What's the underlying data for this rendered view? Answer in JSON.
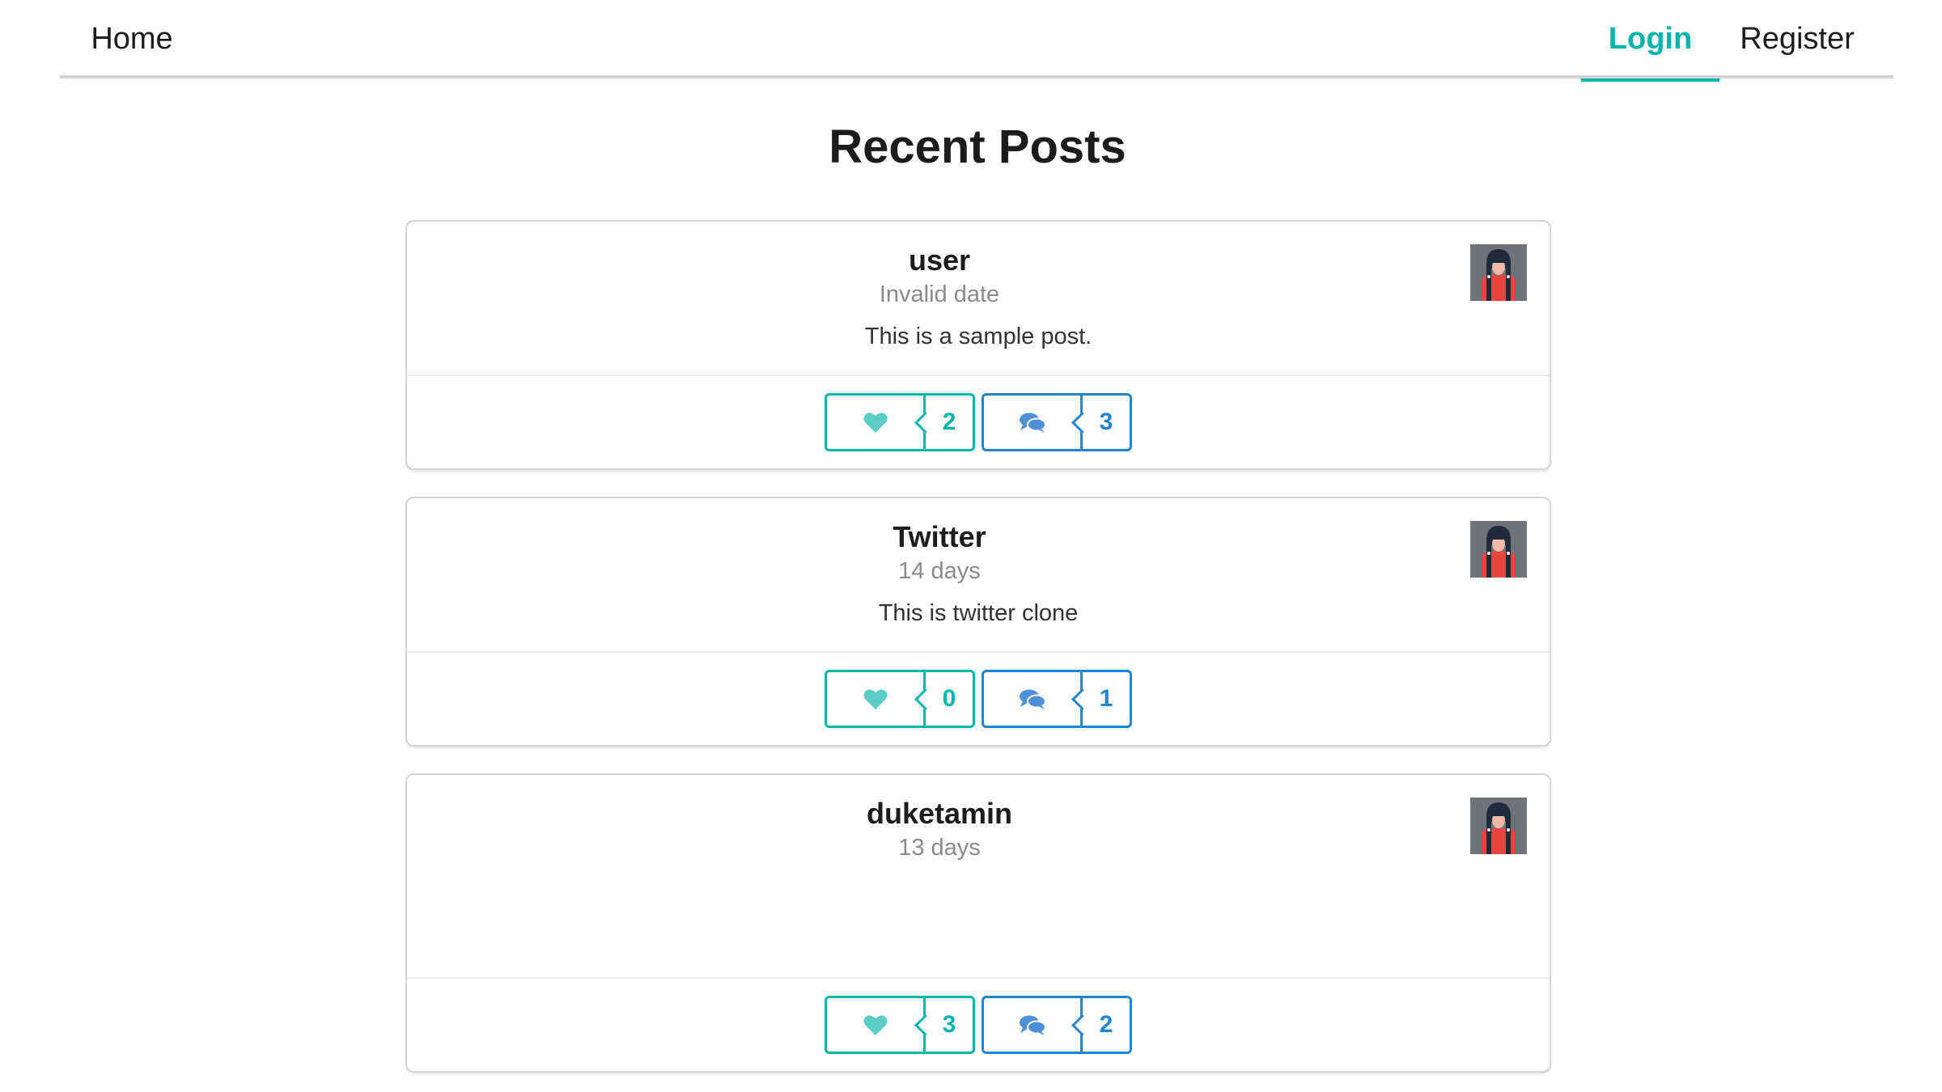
{
  "nav": {
    "home_label": "Home",
    "login_label": "Login",
    "register_label": "Register",
    "active_item": "Login"
  },
  "page": {
    "title": "Recent Posts"
  },
  "colors": {
    "teal": "#00b5ad",
    "blue": "#2185d0"
  },
  "posts": [
    {
      "author": "user",
      "meta": "Invalid date",
      "description": "This is a sample post.",
      "likes": "2",
      "comments": "3",
      "like_icon": "heart-icon",
      "comment_icon": "comments-icon"
    },
    {
      "author": "Twitter",
      "meta": "14 days",
      "description": "This is twitter clone",
      "likes": "0",
      "comments": "1",
      "like_icon": "heart-icon",
      "comment_icon": "comments-icon"
    },
    {
      "author": "duketamin",
      "meta": "13 days",
      "description": "",
      "likes": "3",
      "comments": "2",
      "like_icon": "heart-icon",
      "comment_icon": "comments-icon"
    }
  ]
}
